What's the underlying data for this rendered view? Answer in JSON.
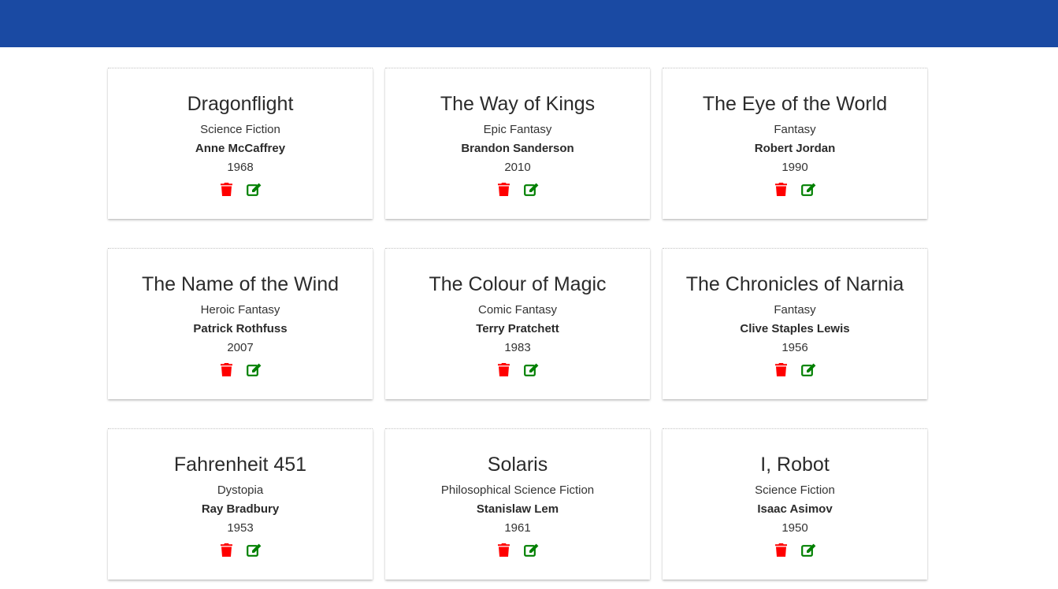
{
  "header": {
    "color": "#1a4aa3"
  },
  "colors": {
    "delete": "#ff0000",
    "edit": "#008000"
  },
  "icons": {
    "delete": "trash-icon",
    "edit": "edit-icon"
  },
  "books": [
    {
      "title": "Dragonflight",
      "genre": "Science Fiction",
      "author": "Anne McCaffrey",
      "year": "1968"
    },
    {
      "title": "The Way of Kings",
      "genre": "Epic Fantasy",
      "author": "Brandon Sanderson",
      "year": "2010"
    },
    {
      "title": "The Eye of the World",
      "genre": "Fantasy",
      "author": "Robert Jordan",
      "year": "1990"
    },
    {
      "title": "The Name of the Wind",
      "genre": "Heroic Fantasy",
      "author": "Patrick Rothfuss",
      "year": "2007"
    },
    {
      "title": "The Colour of Magic",
      "genre": "Comic Fantasy",
      "author": "Terry Pratchett",
      "year": "1983"
    },
    {
      "title": "The Chronicles of Narnia",
      "genre": "Fantasy",
      "author": "Clive Staples Lewis",
      "year": "1956"
    },
    {
      "title": "Fahrenheit 451",
      "genre": "Dystopia",
      "author": "Ray Bradbury",
      "year": "1953"
    },
    {
      "title": "Solaris",
      "genre": "Philosophical Science Fiction",
      "author": "Stanislaw Lem",
      "year": "1961"
    },
    {
      "title": "I, Robot",
      "genre": "Science Fiction",
      "author": "Isaac Asimov",
      "year": "1950"
    }
  ]
}
